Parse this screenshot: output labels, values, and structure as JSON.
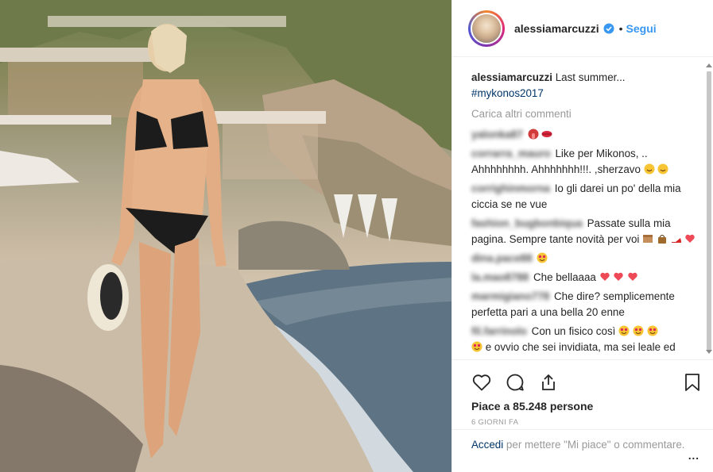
{
  "post": {
    "photo_alt": "alessiamarcuzzi photo"
  },
  "header": {
    "username": "alessiamarcuzzi",
    "separator": "•",
    "follow_label": "Segui"
  },
  "caption": {
    "username": "alessiamarcuzzi",
    "text": "Last summer...",
    "hashtag": "#mykonos2017"
  },
  "load_more_label": "Carica altri commenti",
  "comments": [
    {
      "user": "yalonka87",
      "text": ""
    },
    {
      "user": "corrarra_mauro",
      "text": "Like per Mikonos, .. Ahhhhhhhh. Ahhhhhhh!!!. ,sherzavo"
    },
    {
      "user": "corrighinmorna",
      "text": "Io gli darei un po' della mia ciccia se ne vue"
    },
    {
      "user": "fashion_bugbonbiqua",
      "text": "Passate sulla mia pagina. Sempre tante novità per voi"
    },
    {
      "user": "dina.pace88",
      "text": ""
    },
    {
      "user": "la.mao8788",
      "text": "Che bellaaaa"
    },
    {
      "user": "marmigiano778",
      "text": "Che dire? semplicemente perfetta pari a una bella 20 enne"
    },
    {
      "user": "fil.farrinolo",
      "text": "Con un fisico così"
    },
    {
      "user": "",
      "text": "e ovvio che sei invidiata, ma sei leale ed"
    }
  ],
  "actions": {
    "likes_text": "Piace a 85.248 persone",
    "time_text": "6 GIORNI FA"
  },
  "footer": {
    "login_label": "Accedi",
    "rest_text": " per mettere \"Mi piace\" o commentare.",
    "more_label": "..."
  },
  "colors": {
    "link": "#3897f0",
    "hashtag": "#003569",
    "muted": "#999999",
    "verified": "#3897f0",
    "heart": "#ed4956"
  }
}
